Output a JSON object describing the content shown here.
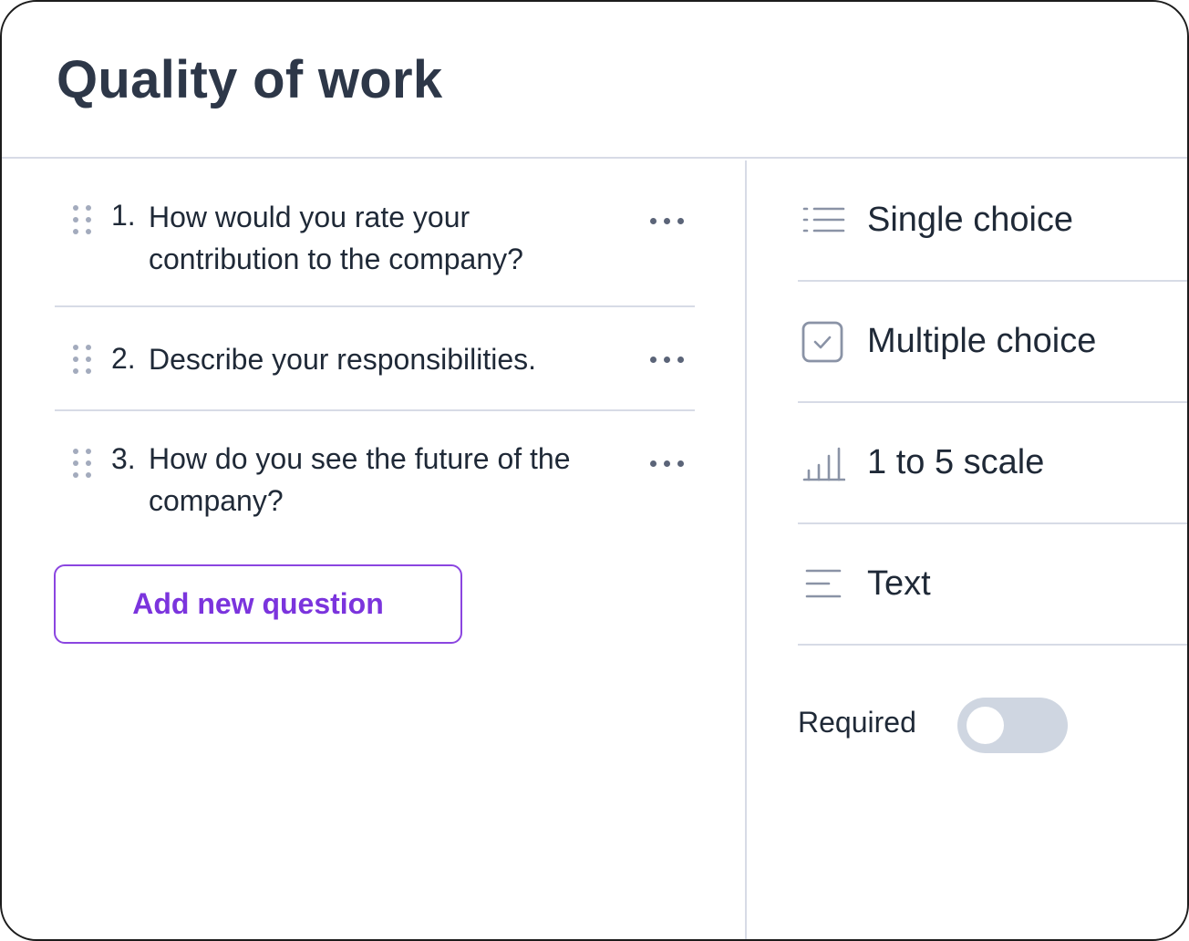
{
  "header": {
    "title": "Quality of work"
  },
  "questions": [
    {
      "number": "1.",
      "text": "How would you rate your contribution to the company?"
    },
    {
      "number": "2.",
      "text": "Describe your responsibilities."
    },
    {
      "number": "3.",
      "text": "How do you see the future of the company?"
    }
  ],
  "add_button": {
    "label": "Add new question"
  },
  "question_types": [
    {
      "label": "Single choice",
      "icon": "list-icon"
    },
    {
      "label": "Multiple choice",
      "icon": "checkbox-icon"
    },
    {
      "label": "1 to 5 scale",
      "icon": "bar-scale-icon"
    },
    {
      "label": "Text",
      "icon": "text-align-icon"
    }
  ],
  "required": {
    "label": "Required",
    "enabled": false
  },
  "colors": {
    "accent": "#7b34dd",
    "divider": "#d7dbe6",
    "toggle_off": "#cfd6e1",
    "title": "#2d3748"
  }
}
